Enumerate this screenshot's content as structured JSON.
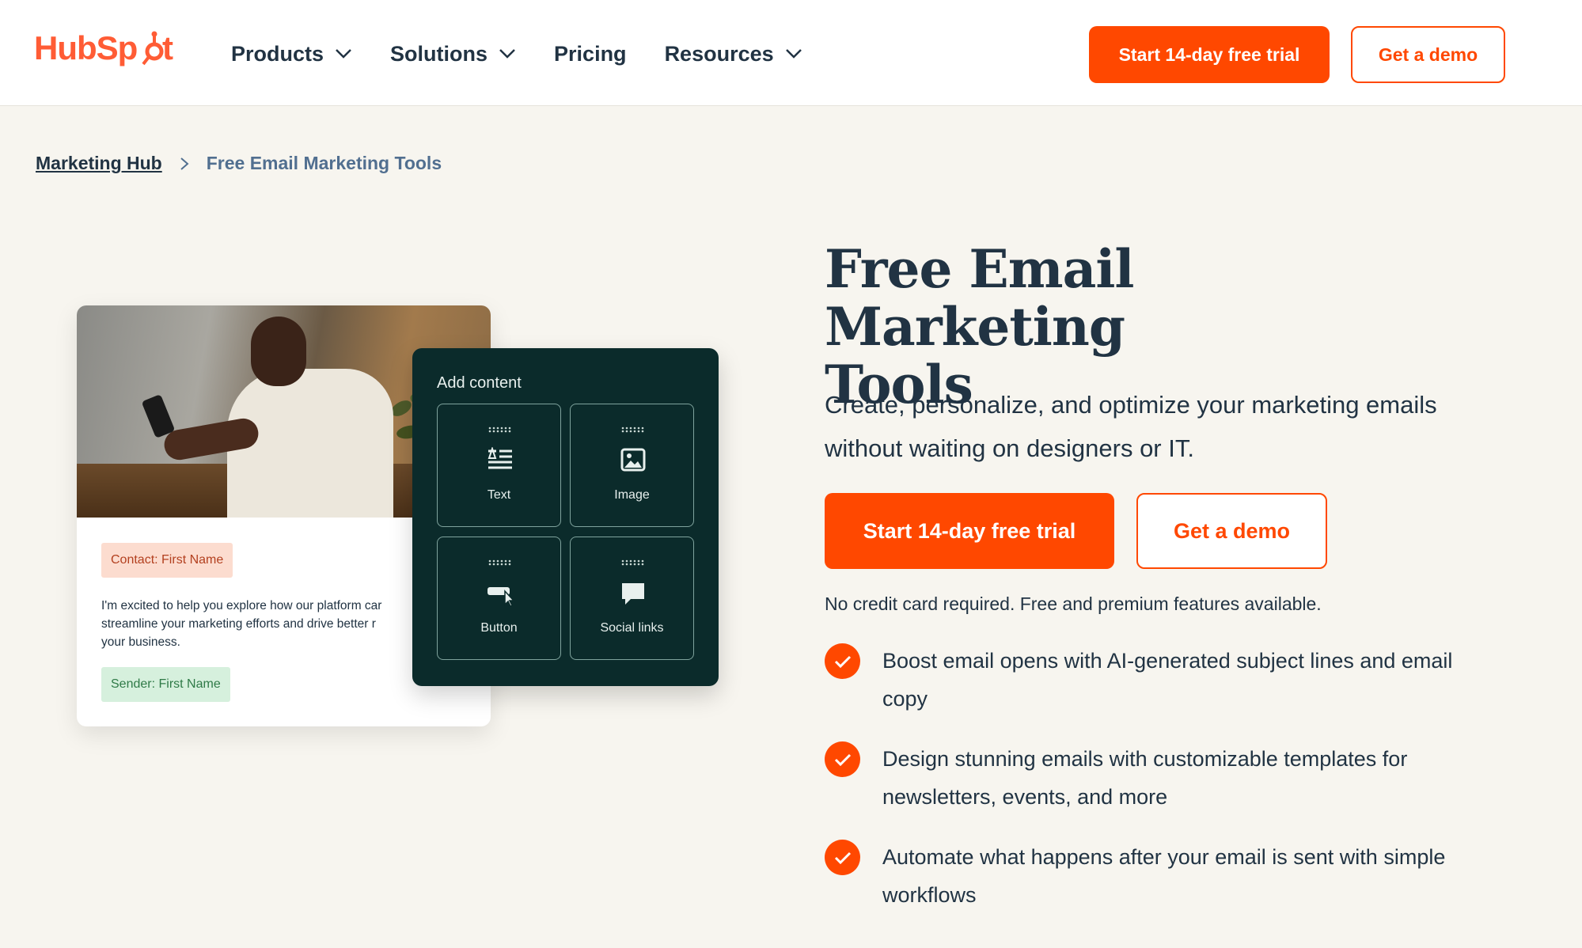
{
  "header": {
    "logo_text": "HubSpot",
    "nav": [
      {
        "label": "Products",
        "has_dropdown": true
      },
      {
        "label": "Solutions",
        "has_dropdown": true
      },
      {
        "label": "Pricing",
        "has_dropdown": false
      },
      {
        "label": "Resources",
        "has_dropdown": true
      }
    ],
    "trial_button": "Start 14-day free trial",
    "demo_button": "Get a demo"
  },
  "breadcrumb": {
    "parent": "Marketing Hub",
    "current": "Free Email Marketing Tools"
  },
  "illustration": {
    "contact_tag": "Contact: First Name",
    "email_lines": [
      "I'm excited to help you explore how our platform car",
      "streamline your marketing efforts and drive better r",
      "your business."
    ],
    "sender_tag": "Sender: First Name",
    "panel_title": "Add content",
    "tiles": [
      {
        "label": "Text",
        "icon": "text-lines-icon"
      },
      {
        "label": "Image",
        "icon": "image-icon"
      },
      {
        "label": "Button",
        "icon": "button-cursor-icon"
      },
      {
        "label": "Social links",
        "icon": "speech-bubble-icon"
      }
    ]
  },
  "hero": {
    "title_line1": "Free Email Marketing",
    "title_line2": "Tools",
    "subtitle_line1": "Create, personalize, and optimize your marketing emails",
    "subtitle_line2": "without waiting on designers or IT.",
    "trial_button": "Start 14-day free trial",
    "demo_button": "Get a demo",
    "note": "No credit card required. Free and premium features available.",
    "features": [
      {
        "line1": "Boost email opens with AI-generated subject lines and email",
        "line2": "copy"
      },
      {
        "line1": "Design stunning emails with customizable templates for",
        "line2": "newsletters, events, and more"
      },
      {
        "line1": "Automate what happens after your email is sent with simple",
        "line2": "workflows"
      }
    ]
  },
  "colors": {
    "brand_orange": "#ff4800",
    "dark_navy": "#213343",
    "panel_green": "#0b2b2b",
    "page_bg": "#f7f5ef"
  }
}
